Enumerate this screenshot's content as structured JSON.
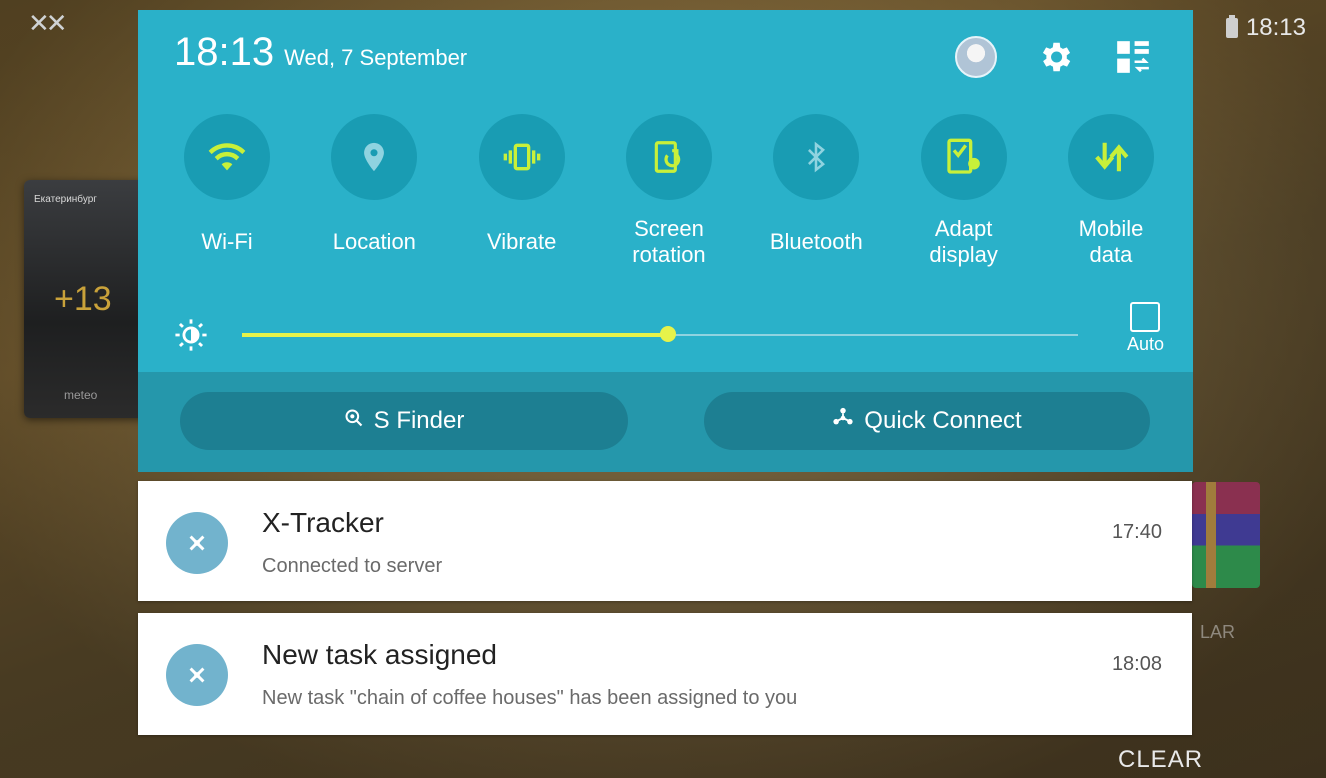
{
  "status_bar": {
    "time": "18:13"
  },
  "home_widgets": {
    "weather": {
      "city": "Екатеринбург",
      "temperature": "+13",
      "brand": "meteo"
    },
    "app_label": "LAR"
  },
  "panel": {
    "time": "18:13",
    "date": "Wed, 7 September",
    "toggles": [
      {
        "label": "Wi-Fi",
        "icon": "wifi-icon",
        "active": true
      },
      {
        "label": "Location",
        "icon": "location-icon",
        "active": false
      },
      {
        "label": "Vibrate",
        "icon": "vibrate-icon",
        "active": true
      },
      {
        "label": "Screen rotation",
        "icon": "screen-rotation-icon",
        "active": true
      },
      {
        "label": "Bluetooth",
        "icon": "bluetooth-icon",
        "active": false
      },
      {
        "label": "Adapt display",
        "icon": "adapt-display-icon",
        "active": true
      },
      {
        "label": "Mobile data",
        "icon": "mobile-data-icon",
        "active": true
      }
    ],
    "brightness": {
      "level": 0.51,
      "auto_label": "Auto",
      "auto_checked": false
    },
    "s_finder_label": "S Finder",
    "quick_connect_label": "Quick Connect"
  },
  "notifications": [
    {
      "title": "X-Tracker",
      "body": "Connected to server",
      "time": "17:40"
    },
    {
      "title": "New task assigned",
      "body": "New task \"chain of coffee houses\" has been assigned to you",
      "time": "18:08"
    }
  ],
  "clear_label": "CLEAR",
  "colors": {
    "panel_bg": "#2ab1c9",
    "toggle_bg": "#199cb3",
    "active_accent": "#c8f03a",
    "inactive_icon": "#8fd3e0",
    "notification_icon_bg": "#72b3cd"
  }
}
